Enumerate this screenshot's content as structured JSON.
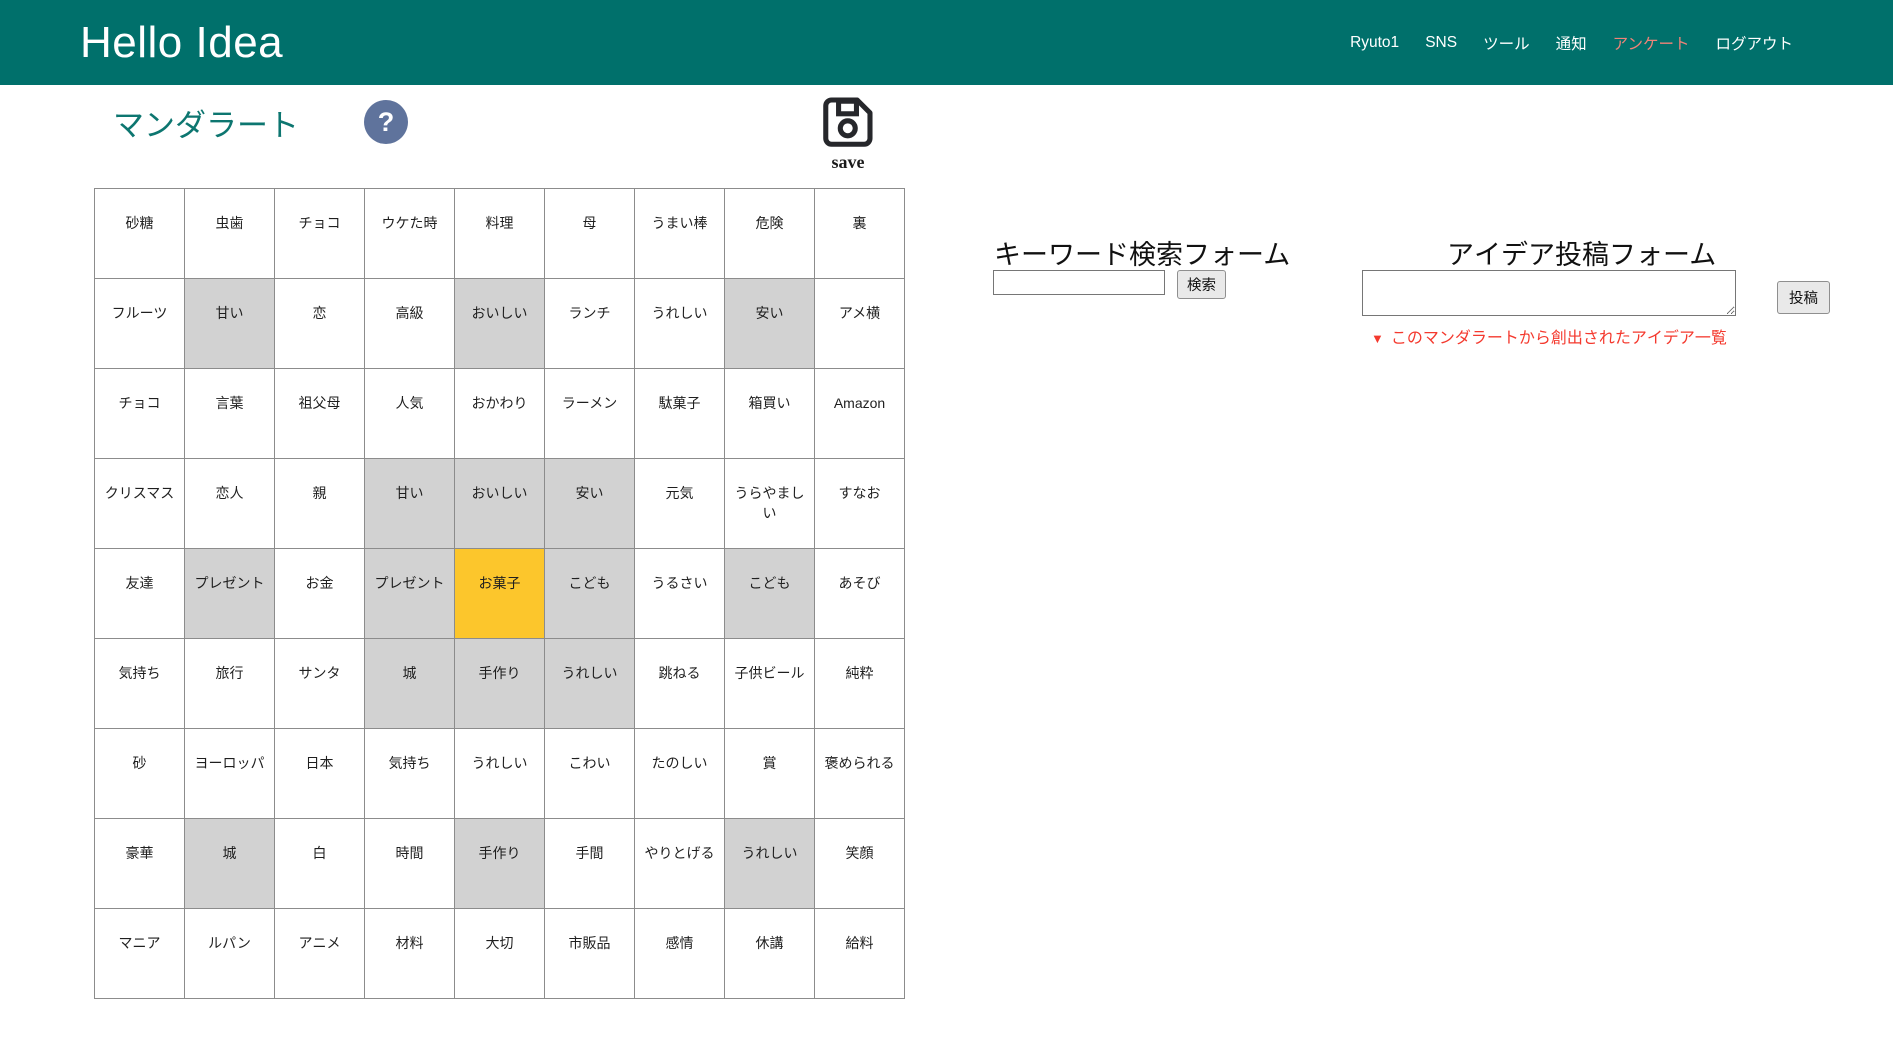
{
  "header": {
    "brand": "Hello Idea",
    "accent_color": "#00706b",
    "nav_active_color": "#ef8378",
    "nav": [
      {
        "label": "Ryuto1",
        "active": false
      },
      {
        "label": "SNS",
        "active": false
      },
      {
        "label": "ツール",
        "active": false
      },
      {
        "label": "通知",
        "active": false
      },
      {
        "label": "アンケート",
        "active": true
      },
      {
        "label": "ログアウト",
        "active": false
      }
    ]
  },
  "page": {
    "title": "マンダラート",
    "title_color": "#0d7670",
    "help_icon_glyph": "?",
    "help_icon_color": "#5f739c",
    "save_label": "save"
  },
  "grid": {
    "colors": {
      "related": "#d2d2d2",
      "selected_center": "#fcc62c",
      "border": "#8c8c8c"
    },
    "rows": [
      [
        {
          "t": "砂糖",
          "s": ""
        },
        {
          "t": "虫歯",
          "s": ""
        },
        {
          "t": "チョコ",
          "s": ""
        },
        {
          "t": "ウケた時",
          "s": ""
        },
        {
          "t": "料理",
          "s": ""
        },
        {
          "t": "母",
          "s": ""
        },
        {
          "t": "うまい棒",
          "s": ""
        },
        {
          "t": "危険",
          "s": ""
        },
        {
          "t": "裏",
          "s": ""
        }
      ],
      [
        {
          "t": "フルーツ",
          "s": ""
        },
        {
          "t": "甘い",
          "s": "g"
        },
        {
          "t": "恋",
          "s": ""
        },
        {
          "t": "高級",
          "s": ""
        },
        {
          "t": "おいしい",
          "s": "g"
        },
        {
          "t": "ランチ",
          "s": ""
        },
        {
          "t": "うれしい",
          "s": ""
        },
        {
          "t": "安い",
          "s": "g"
        },
        {
          "t": "アメ横",
          "s": ""
        }
      ],
      [
        {
          "t": "チョコ",
          "s": ""
        },
        {
          "t": "言葉",
          "s": ""
        },
        {
          "t": "祖父母",
          "s": ""
        },
        {
          "t": "人気",
          "s": ""
        },
        {
          "t": "おかわり",
          "s": ""
        },
        {
          "t": "ラーメン",
          "s": ""
        },
        {
          "t": "駄菓子",
          "s": ""
        },
        {
          "t": "箱買い",
          "s": ""
        },
        {
          "t": "Amazon",
          "s": ""
        }
      ],
      [
        {
          "t": "クリスマス",
          "s": ""
        },
        {
          "t": "恋人",
          "s": ""
        },
        {
          "t": "親",
          "s": ""
        },
        {
          "t": "甘い",
          "s": "g"
        },
        {
          "t": "おいしい",
          "s": "g"
        },
        {
          "t": "安い",
          "s": "g"
        },
        {
          "t": "元気",
          "s": ""
        },
        {
          "t": "うらやましい",
          "s": ""
        },
        {
          "t": "すなお",
          "s": ""
        }
      ],
      [
        {
          "t": "友達",
          "s": ""
        },
        {
          "t": "プレゼント",
          "s": "g"
        },
        {
          "t": "お金",
          "s": ""
        },
        {
          "t": "プレゼント",
          "s": "g"
        },
        {
          "t": "お菓子",
          "s": "c"
        },
        {
          "t": "こども",
          "s": "g"
        },
        {
          "t": "うるさい",
          "s": ""
        },
        {
          "t": "こども",
          "s": "g"
        },
        {
          "t": "あそび",
          "s": ""
        }
      ],
      [
        {
          "t": "気持ち",
          "s": ""
        },
        {
          "t": "旅行",
          "s": ""
        },
        {
          "t": "サンタ",
          "s": ""
        },
        {
          "t": "城",
          "s": "g"
        },
        {
          "t": "手作り",
          "s": "g"
        },
        {
          "t": "うれしい",
          "s": "g"
        },
        {
          "t": "跳ねる",
          "s": ""
        },
        {
          "t": "子供ビール",
          "s": ""
        },
        {
          "t": "純粋",
          "s": ""
        }
      ],
      [
        {
          "t": "砂",
          "s": ""
        },
        {
          "t": "ヨーロッパ",
          "s": ""
        },
        {
          "t": "日本",
          "s": ""
        },
        {
          "t": "気持ち",
          "s": ""
        },
        {
          "t": "うれしい",
          "s": ""
        },
        {
          "t": "こわい",
          "s": ""
        },
        {
          "t": "たのしい",
          "s": ""
        },
        {
          "t": "賞",
          "s": ""
        },
        {
          "t": "褒められる",
          "s": ""
        }
      ],
      [
        {
          "t": "豪華",
          "s": ""
        },
        {
          "t": "城",
          "s": "g"
        },
        {
          "t": "白",
          "s": ""
        },
        {
          "t": "時間",
          "s": ""
        },
        {
          "t": "手作り",
          "s": "g"
        },
        {
          "t": "手間",
          "s": ""
        },
        {
          "t": "やりとげる",
          "s": ""
        },
        {
          "t": "うれしい",
          "s": "g"
        },
        {
          "t": "笑顔",
          "s": ""
        }
      ],
      [
        {
          "t": "マニア",
          "s": ""
        },
        {
          "t": "ルパン",
          "s": ""
        },
        {
          "t": "アニメ",
          "s": ""
        },
        {
          "t": "材料",
          "s": ""
        },
        {
          "t": "大切",
          "s": ""
        },
        {
          "t": "市販品",
          "s": ""
        },
        {
          "t": "感情",
          "s": ""
        },
        {
          "t": "休講",
          "s": ""
        },
        {
          "t": "給料",
          "s": ""
        }
      ]
    ]
  },
  "search_form": {
    "title": "キーワード検索フォーム",
    "input_value": "",
    "input_placeholder": "",
    "button_label": "検索"
  },
  "idea_form": {
    "title": "アイデア投稿フォーム",
    "textarea_value": "",
    "textarea_placeholder": "",
    "button_label": "投稿",
    "toggle_marker": "▼",
    "toggle_label": "このマンダラートから創出されたアイデア一覧",
    "toggle_color": "#f4392e"
  }
}
